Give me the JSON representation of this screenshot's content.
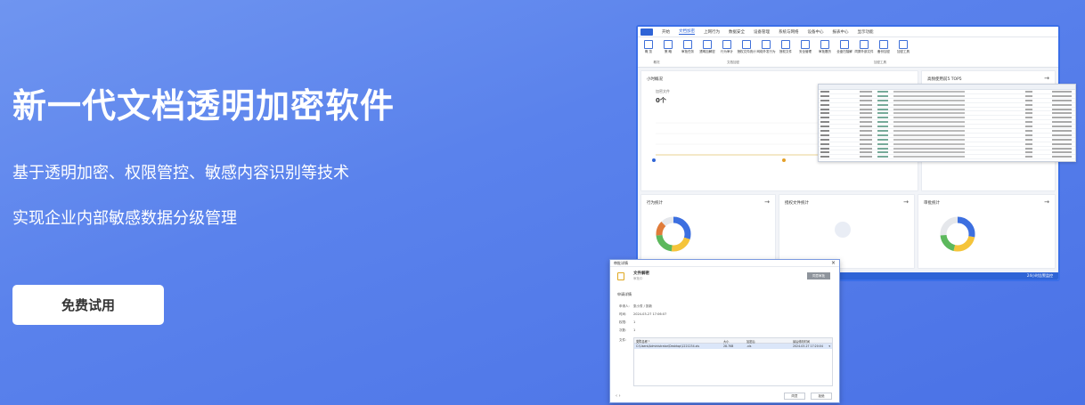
{
  "hero": {
    "title": "新一代文档透明加密软件",
    "subtitle_line1": "基于透明加密、权限管控、敏感内容识别等技术",
    "subtitle_line2": "实现企业内部敏感数据分级管理",
    "cta_label": "免费试用"
  },
  "app": {
    "menu": [
      "开始",
      "文档加密",
      "上网行为",
      "数据安全",
      "设备管理",
      "系统与网络",
      "设备中心",
      "报表中心",
      "显示功能"
    ],
    "active_menu_index": 1,
    "ribbon_buttons": [
      "概 览",
      "策 略",
      "审批任务",
      "透明加解密",
      "行为审计",
      "授权文件统计",
      "网络外发行为",
      "授权文件",
      "安全管理",
      "审批履历",
      "全盘扫描解",
      "同屏外部文件",
      "备份加密",
      "加密工具"
    ],
    "group_labels": [
      "概况",
      "文档加密",
      "加密工具"
    ],
    "panels": {
      "overview_title": "小时概况",
      "overview_metric_label": "加密文件",
      "overview_metric_value": "0个",
      "top_apps_title": "高频使用前5 TOP5",
      "behavior_title": "行为统计",
      "auth_title": "授权文件统计",
      "audit_title": "审批统计"
    },
    "status_text": "24小时告警监控"
  },
  "dialog": {
    "title": "审批详情",
    "file_name": "文件解密",
    "state": "审批中",
    "action_button": "同意审批",
    "section": "申请详情",
    "fields": [
      {
        "label": "申请人:",
        "value": "张小芳 / 张新"
      },
      {
        "label": "时间:",
        "value": "2024-03-27 17:06:07"
      },
      {
        "label": "权限:",
        "value": "1"
      },
      {
        "label": "次数:",
        "value": "1"
      }
    ],
    "files_label": "文件:",
    "table_headers": [
      "文件名称",
      "大小",
      "加密后",
      "最后修改时间"
    ],
    "table_row": [
      "C:\\Users\\Administrator\\Desktop\\1221234.xls",
      "28.7KB",
      ".xls",
      "2024-03-27 17:20:04"
    ],
    "pager": "总数 1 of 1",
    "btn_approve": "同意",
    "btn_reject": "拒绝"
  },
  "colors": {
    "background_start": "#6f95f0",
    "background_end": "#4a72e6",
    "accent": "#2f64d6",
    "cta_bg": "#ffffff"
  }
}
